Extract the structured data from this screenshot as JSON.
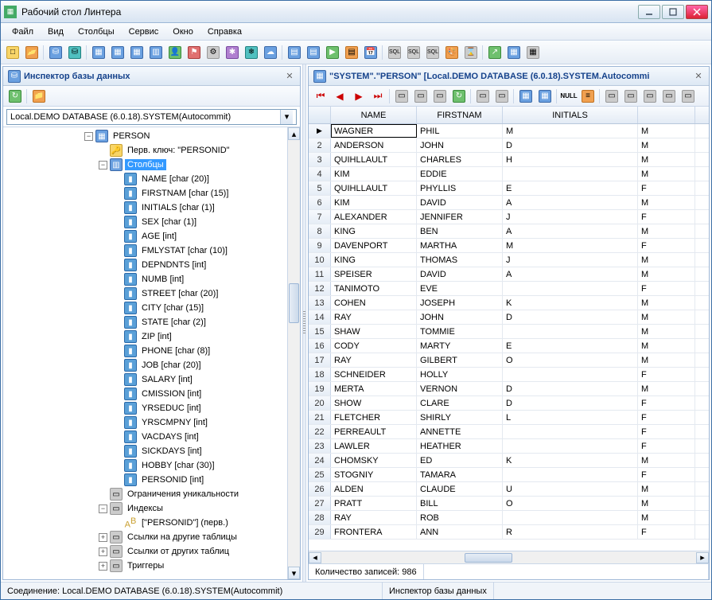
{
  "window": {
    "title": "Рабочий стол Линтера"
  },
  "menu": [
    "Файл",
    "Вид",
    "Столбцы",
    "Сервис",
    "Окно",
    "Справка"
  ],
  "inspector": {
    "title": "Инспектор базы данных",
    "combo": "Local.DEMO DATABASE (6.0.18).SYSTEM(Autocommit)",
    "tree": {
      "person": "PERSON",
      "pk": "Перв. ключ: \"PERSONID\"",
      "columns_node": "Столбцы",
      "columns": [
        "NAME [char (20)]",
        "FIRSTNAM [char (15)]",
        "INITIALS [char (1)]",
        "SEX [char (1)]",
        "AGE [int]",
        "FMLYSTAT [char (10)]",
        "DEPNDNTS [int]",
        "NUMB [int]",
        "STREET [char (20)]",
        "CITY [char (15)]",
        "STATE [char (2)]",
        "ZIP [int]",
        "PHONE [char (8)]",
        "JOB [char (20)]",
        "SALARY [int]",
        "CMISSION [int]",
        "YRSEDUC [int]",
        "YRSCMPNY [int]",
        "VACDAYS [int]",
        "SICKDAYS [int]",
        "HOBBY [char (30)]",
        "PERSONID [int]"
      ],
      "unique": "Ограничения уникальности",
      "indexes": "Индексы",
      "index_item": "[\"PERSONID\"] (перв.)",
      "fk_to": "Ссылки на другие таблицы",
      "fk_from": "Ссылки от других таблиц",
      "triggers": "Триггеры"
    }
  },
  "grid": {
    "title": "\"SYSTEM\".\"PERSON\" [Local.DEMO DATABASE (6.0.18).SYSTEM.Autocommi",
    "headers": [
      "NAME",
      "FIRSTNAM",
      "INITIALS",
      ""
    ],
    "rows": [
      {
        "n": 1,
        "name": "WAGNER",
        "first": "PHIL",
        "init": "M",
        "sex": "M"
      },
      {
        "n": 2,
        "name": "ANDERSON",
        "first": "JOHN",
        "init": "D",
        "sex": "M"
      },
      {
        "n": 3,
        "name": "QUIHLLAULT",
        "first": "CHARLES",
        "init": "H",
        "sex": "M"
      },
      {
        "n": 4,
        "name": "KIM",
        "first": "EDDIE",
        "init": "",
        "sex": "M"
      },
      {
        "n": 5,
        "name": "QUIHLLAULT",
        "first": "PHYLLIS",
        "init": "E",
        "sex": "F"
      },
      {
        "n": 6,
        "name": "KIM",
        "first": "DAVID",
        "init": "A",
        "sex": "M"
      },
      {
        "n": 7,
        "name": "ALEXANDER",
        "first": "JENNIFER",
        "init": "J",
        "sex": "F"
      },
      {
        "n": 8,
        "name": "KING",
        "first": "BEN",
        "init": "A",
        "sex": "M"
      },
      {
        "n": 9,
        "name": "DAVENPORT",
        "first": "MARTHA",
        "init": "M",
        "sex": "F"
      },
      {
        "n": 10,
        "name": "KING",
        "first": "THOMAS",
        "init": "J",
        "sex": "M"
      },
      {
        "n": 11,
        "name": "SPEISER",
        "first": "DAVID",
        "init": "A",
        "sex": "M"
      },
      {
        "n": 12,
        "name": "TANIMOTO",
        "first": "EVE",
        "init": "",
        "sex": "F"
      },
      {
        "n": 13,
        "name": "COHEN",
        "first": "JOSEPH",
        "init": "K",
        "sex": "M"
      },
      {
        "n": 14,
        "name": "RAY",
        "first": "JOHN",
        "init": "D",
        "sex": "M"
      },
      {
        "n": 15,
        "name": "SHAW",
        "first": "TOMMIE",
        "init": "",
        "sex": "M"
      },
      {
        "n": 16,
        "name": "CODY",
        "first": "MARTY",
        "init": "E",
        "sex": "M"
      },
      {
        "n": 17,
        "name": "RAY",
        "first": "GILBERT",
        "init": "O",
        "sex": "M"
      },
      {
        "n": 18,
        "name": "SCHNEIDER",
        "first": "HOLLY",
        "init": "",
        "sex": "F"
      },
      {
        "n": 19,
        "name": "MERTA",
        "first": "VERNON",
        "init": "D",
        "sex": "M"
      },
      {
        "n": 20,
        "name": "SHOW",
        "first": "CLARE",
        "init": "D",
        "sex": "F"
      },
      {
        "n": 21,
        "name": "FLETCHER",
        "first": "SHIRLY",
        "init": "L",
        "sex": "F"
      },
      {
        "n": 22,
        "name": "PERREAULT",
        "first": "ANNETTE",
        "init": "",
        "sex": "F"
      },
      {
        "n": 23,
        "name": "LAWLER",
        "first": "HEATHER",
        "init": "",
        "sex": "F"
      },
      {
        "n": 24,
        "name": "CHOMSKY",
        "first": "ED",
        "init": "K",
        "sex": "M"
      },
      {
        "n": 25,
        "name": "STOGNIY",
        "first": "TAMARA",
        "init": "",
        "sex": "F"
      },
      {
        "n": 26,
        "name": "ALDEN",
        "first": "CLAUDE",
        "init": "U",
        "sex": "M"
      },
      {
        "n": 27,
        "name": "PRATT",
        "first": "BILL",
        "init": "O",
        "sex": "M"
      },
      {
        "n": 28,
        "name": "RAY",
        "first": "ROB",
        "init": "",
        "sex": "M"
      },
      {
        "n": 29,
        "name": "FRONTERA",
        "first": "ANN",
        "init": "R",
        "sex": "F"
      }
    ],
    "footer": "Количество записей: 986"
  },
  "status": {
    "conn": "Соединение: Local.DEMO DATABASE (6.0.18).SYSTEM(Autocommit)",
    "right": "Инспектор базы данных"
  },
  "toolbar_right_labels": {
    "null": "NULL"
  }
}
